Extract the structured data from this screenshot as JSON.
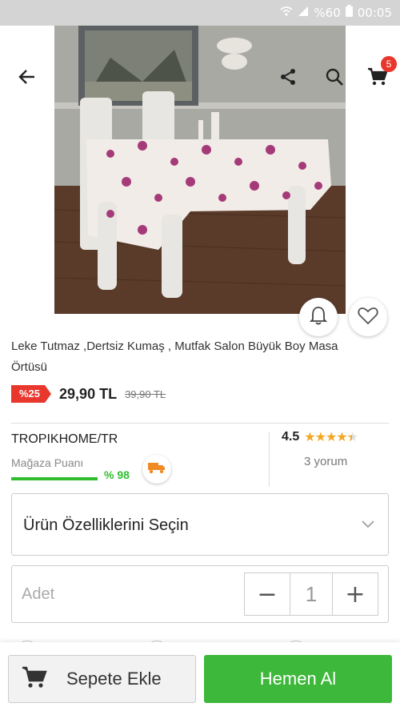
{
  "status_bar": {
    "battery_text": "%60",
    "time": "00:05"
  },
  "header": {
    "cart_count": "5"
  },
  "product": {
    "title": "Leke Tutmaz ,Dertsiz Kumaş , Mutfak Salon Büyük Boy Masa Örtüsü",
    "discount_badge": "%25",
    "price": "29,90 TL",
    "old_price": "39,90 TL"
  },
  "store": {
    "name": "TROPIKHOME/TR",
    "score_label": "Mağaza Puanı",
    "score_value": "% 98",
    "score_fraction": 0.98,
    "rating": "4.5",
    "reviews": "3 yorum"
  },
  "options": {
    "select_label": "Ürün Özelliklerini Seçin"
  },
  "quantity": {
    "label": "Adet",
    "minus": "−",
    "value": "1",
    "plus": "+"
  },
  "actions": {
    "add_to_cart": "Sepete Ekle",
    "buy_now": "Hemen Al"
  },
  "colors": {
    "accent_green": "#3db83a",
    "discount_red": "#e8372d",
    "star": "#f5a623"
  },
  "icons": [
    "back-arrow-icon",
    "share-icon",
    "search-icon",
    "cart-icon",
    "bell-icon",
    "heart-icon",
    "truck-icon",
    "chevron-down-icon",
    "wifi-icon",
    "signal-icon",
    "battery-icon"
  ]
}
